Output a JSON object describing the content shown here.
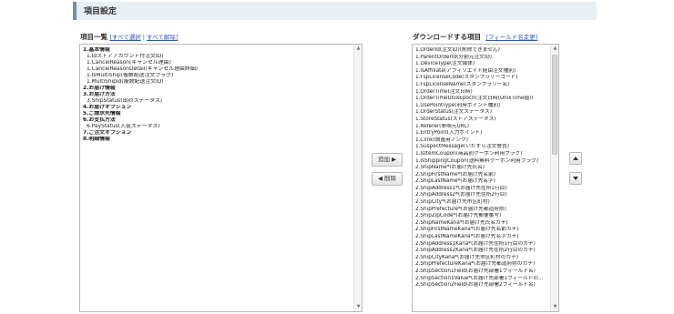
{
  "section_title": "項目設定",
  "left_panel": {
    "title": "項目一覧",
    "select_all": "[すべて選択",
    "separator": " | ",
    "deselect_all": "すべて解除]",
    "items": [
      {
        "text": "1.基本情報",
        "bold": true
      },
      {
        "text": "1.Idストアアカウント付注文ID)",
        "bold": false
      },
      {
        "text": "1.CancelReason(キャンセル理由)",
        "bold": false
      },
      {
        "text": "1.CancelReasonDetail(キャンセル理由詳細)",
        "bold": false
      },
      {
        "text": "1.IsMultiShip(複数配送注文フラグ)",
        "bold": false
      },
      {
        "text": "1.MultiShipId(複数配送注文ID)",
        "bold": false
      },
      {
        "text": "2.お届け情報",
        "bold": true
      },
      {
        "text": "3.お届け方法",
        "bold": true
      },
      {
        "text": "3.ShipStatus(出荷ステータス)",
        "bold": false
      },
      {
        "text": "4.お届けオプション",
        "bold": true
      },
      {
        "text": "5.ご請求先情報",
        "bold": true
      },
      {
        "text": "6.お支払方法",
        "bold": true
      },
      {
        "text": "6.PayStatus(入金ステータス)",
        "bold": false
      },
      {
        "text": "7.ご注文オプション",
        "bold": true
      },
      {
        "text": "8.明細情報",
        "bold": true
      }
    ]
  },
  "right_panel": {
    "title": "ダウンロードする項目",
    "field_name_link": "[フィールド名変更]",
    "items": [
      "1.OrderId(注文ID)(削除できません)",
      "1.ParentOrderId(分割元注文ID)",
      "1.DeviceType(注文媒体)",
      "1.IsAffiliate(アフィリエイト経由注文種別)",
      "1.FspLicenseCode(スタンプラリーコード)",
      "1.FspLicenseName(スタンプラリー名)",
      "1.OrderTime(注文日時)",
      "1.OrderTimeUnixEpoch(注文日時(UnixTime値))",
      "1.UsePointType(利用ポイント種別)",
      "1.OrderStatus(注文ステータス)",
      "1.StoreStatus(ストアステータス)",
      "1.Referer(参照元URL)",
      "1.EntryPoint(入力ポイント)",
      "1.Clink(調査用ノンク)",
      "1.SuspectMessage(いたずら注文警告)",
      "1.IsItemCoupon(商品別クーポン利用フラグ)",
      "1.IsShippingCoupon(送料無料クーポン利用フラグ)",
      "2.ShipName*(お届け先氏名)",
      "2.ShipFirstName*(お届け先名前)",
      "2.ShipLastName*(お届け先名字)",
      "2.ShipAddress1*(お届け先住所1行目)",
      "2.ShipAddress2*(お届け先住所2行目)",
      "2.ShipCity*(お届け先市区町村)",
      "2.ShipPrefecture*(お届け先都道府県)",
      "2.ShipZipCode*(お届け先郵便番号)",
      "2.ShipNameKana*(お届け先氏名カナ)",
      "2.ShipFirstNameKana*(お届け先名前カナ)",
      "2.ShipLastNameKana*(お届け先名字カナ)",
      "2.ShipAddress1Kana*(お届け先住所1行目のカナ)",
      "2.ShipAddress2Kana*(お届け先住所2行目のカナ)",
      "2.ShipCityKana*(お届け先市区町村のカナ)",
      "2.ShipPrefectureKana*(お届け先都道府県のカナ)",
      "2.ShipSection1Field(お届け先部署1フィールド名)",
      "2.ShipSection1Value*(お届け先部署1フィールドの...",
      "2.ShipSection2Field(お届け先部署2フィールド名)"
    ]
  },
  "buttons": {
    "add": "追加 ▶",
    "remove": "◀ 削除"
  }
}
